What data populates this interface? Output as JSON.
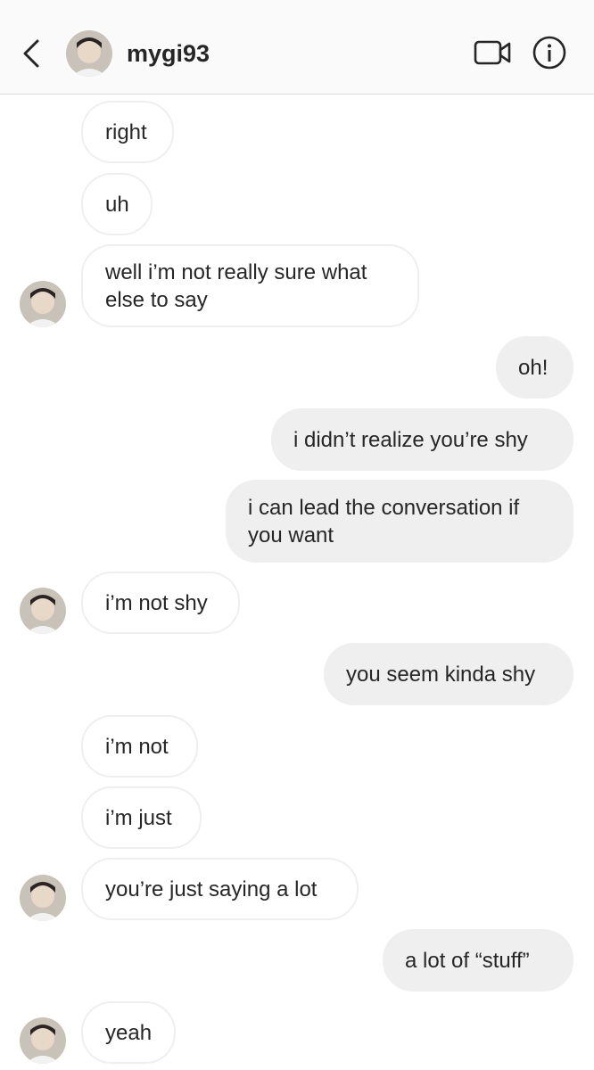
{
  "header": {
    "username": "mygi93",
    "back_icon": "chevron-left-icon",
    "video_icon": "video-camera-icon",
    "info_icon": "info-icon"
  },
  "messages": [
    {
      "sender": "them",
      "text": "right"
    },
    {
      "sender": "them",
      "text": "uh"
    },
    {
      "sender": "them",
      "text": "well i’m not really sure what else to say"
    },
    {
      "sender": "me",
      "text": "oh!"
    },
    {
      "sender": "me",
      "text": "i didn’t realize you’re shy"
    },
    {
      "sender": "me",
      "text": "i can lead the conversation if you want"
    },
    {
      "sender": "them",
      "text": "i’m not shy"
    },
    {
      "sender": "me",
      "text": "you seem kinda shy"
    },
    {
      "sender": "them",
      "text": "i’m not"
    },
    {
      "sender": "them",
      "text": "i’m just"
    },
    {
      "sender": "them",
      "text": "you’re just saying a lot"
    },
    {
      "sender": "me",
      "text": "a lot of “stuff”"
    },
    {
      "sender": "them",
      "text": "yeah"
    }
  ],
  "colors": {
    "incoming_border": "#efefef",
    "outgoing_bg": "#efefef",
    "text": "#262626",
    "header_bg": "#fafafa"
  }
}
